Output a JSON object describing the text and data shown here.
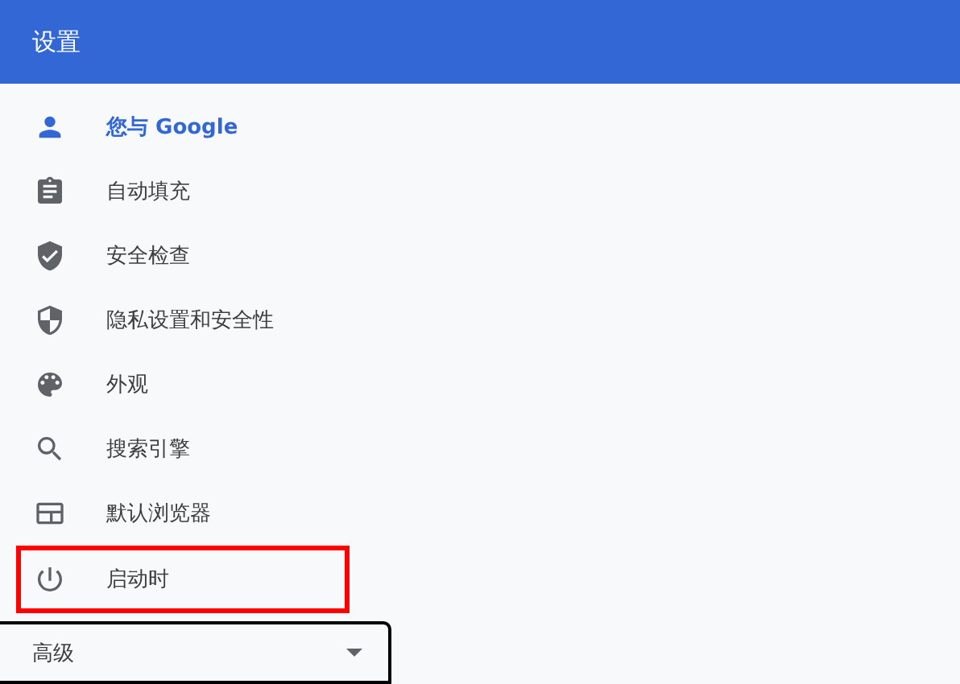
{
  "header": {
    "title": "设置"
  },
  "menu": [
    {
      "label": "您与 Google",
      "kind": "person",
      "selected": true,
      "highlighted": false
    },
    {
      "label": "自动填充",
      "kind": "clipboard",
      "selected": false,
      "highlighted": false
    },
    {
      "label": "安全检查",
      "kind": "shield-check",
      "selected": false,
      "highlighted": false
    },
    {
      "label": "隐私设置和安全性",
      "kind": "shield-half",
      "selected": false,
      "highlighted": false
    },
    {
      "label": "外观",
      "kind": "palette",
      "selected": false,
      "highlighted": false
    },
    {
      "label": "搜索引擎",
      "kind": "search",
      "selected": false,
      "highlighted": false
    },
    {
      "label": "默认浏览器",
      "kind": "browser",
      "selected": false,
      "highlighted": false
    },
    {
      "label": "启动时",
      "kind": "power",
      "selected": false,
      "highlighted": true
    }
  ],
  "advanced": {
    "label": "高级",
    "expanded": false
  }
}
